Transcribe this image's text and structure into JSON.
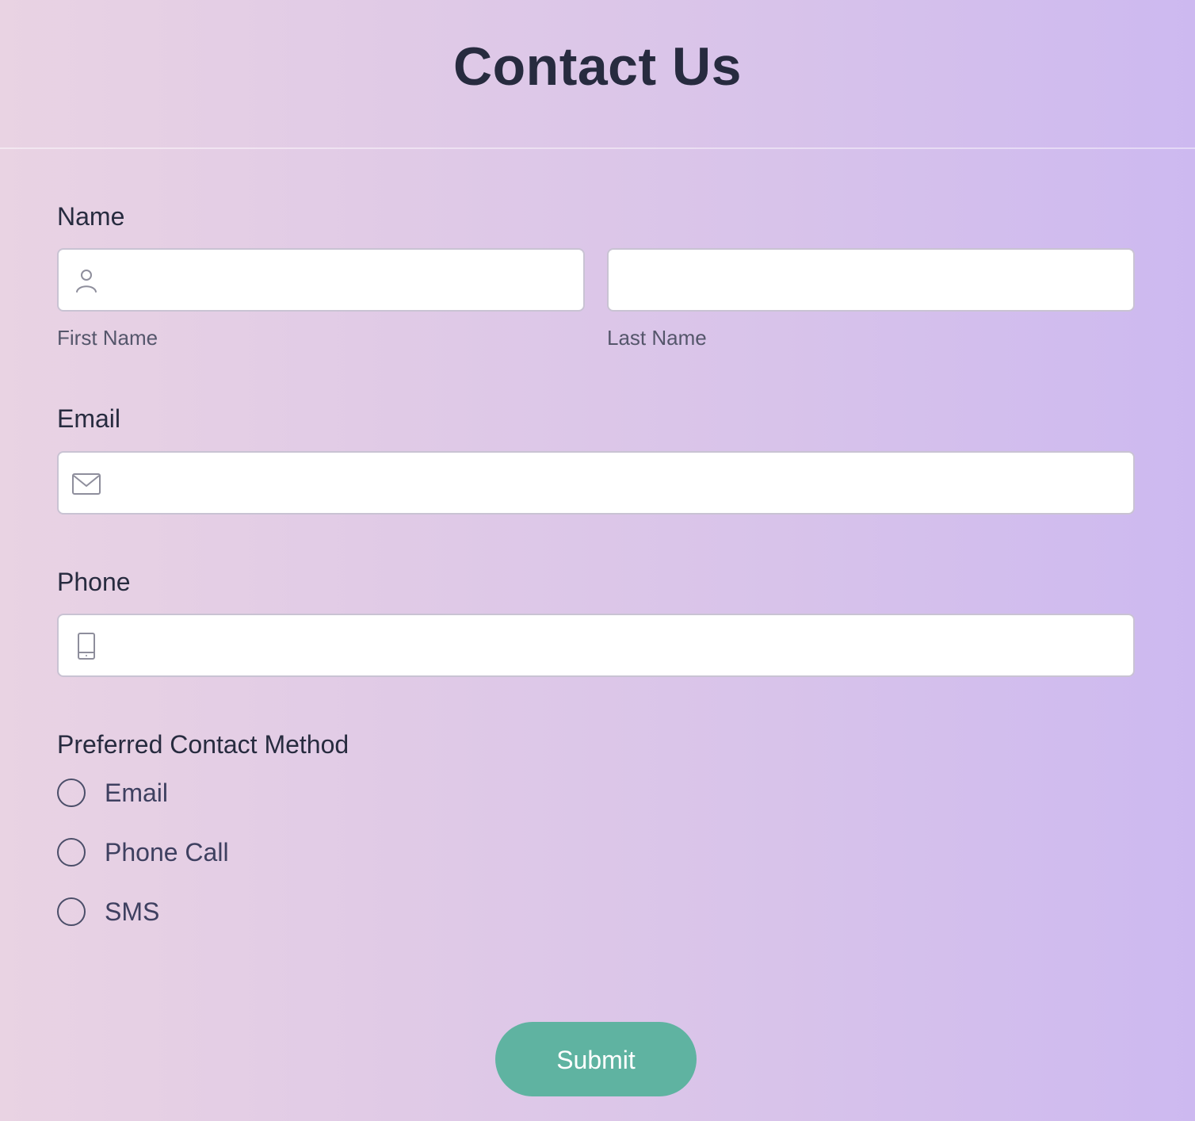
{
  "page": {
    "title": "Contact Us"
  },
  "form": {
    "name": {
      "label": "Name",
      "first_value": "",
      "first_placeholder": "",
      "first_sublabel": "First Name",
      "last_value": "",
      "last_placeholder": "",
      "last_sublabel": "Last Name",
      "icon": "user-icon"
    },
    "email": {
      "label": "Email",
      "value": "",
      "placeholder": "",
      "icon": "envelope-icon"
    },
    "phone": {
      "label": "Phone",
      "value": "",
      "placeholder": "",
      "icon": "phone-icon"
    },
    "contact_method": {
      "label": "Preferred Contact Method",
      "options": [
        {
          "label": "Email",
          "selected": false
        },
        {
          "label": "Phone Call",
          "selected": false
        },
        {
          "label": "SMS",
          "selected": false
        }
      ]
    },
    "submit_label": "Submit"
  },
  "colors": {
    "background_start": "#e9d3e3",
    "background_end": "#cdb9f0",
    "text": "#272b3f",
    "submit_bg": "#5fb3a1",
    "field_border": "#c9c3d3"
  }
}
